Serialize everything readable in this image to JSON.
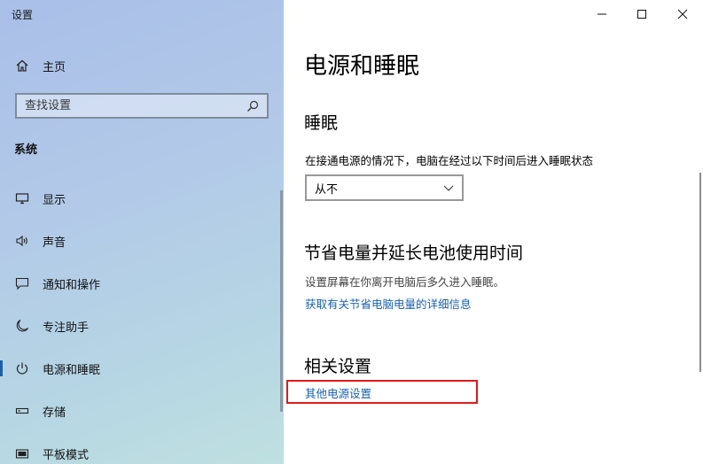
{
  "window": {
    "title": "设置"
  },
  "sidebar": {
    "home_label": "主页",
    "search": {
      "placeholder": "查找设置"
    },
    "section_label": "系统",
    "items": [
      {
        "label": "显示",
        "icon": "monitor-icon"
      },
      {
        "label": "声音",
        "icon": "speaker-icon"
      },
      {
        "label": "通知和操作",
        "icon": "notification-icon"
      },
      {
        "label": "专注助手",
        "icon": "moon-icon"
      },
      {
        "label": "电源和睡眠",
        "icon": "power-icon",
        "active": true
      },
      {
        "label": "存储",
        "icon": "storage-icon"
      },
      {
        "label": "平板模式",
        "icon": "tablet-icon"
      }
    ]
  },
  "main": {
    "title": "电源和睡眠",
    "sleep": {
      "heading": "睡眠",
      "description": "在接通电源的情况下，电脑在经过以下时间后进入睡眠状态",
      "dropdown_value": "从不"
    },
    "battery": {
      "heading": "节省电量并延长电池使用时间",
      "description": "设置屏幕在你离开电脑后多久进入睡眠。",
      "link": "获取有关节省电脑电量的详细信息"
    },
    "related": {
      "heading": "相关设置",
      "link": "其他电源设置"
    }
  },
  "colors": {
    "accent": "#1c5fa8",
    "link": "#1761b2",
    "highlight": "#e01a1a"
  }
}
